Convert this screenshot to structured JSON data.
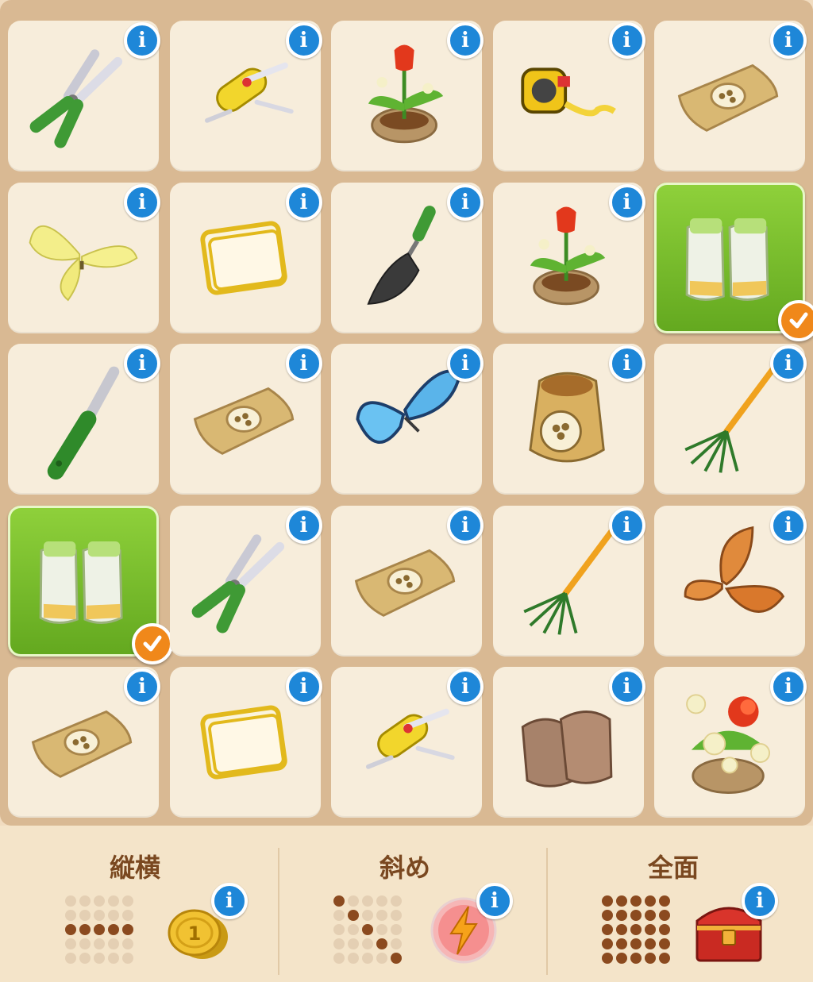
{
  "grid": {
    "rows": 5,
    "cols": 5,
    "cells": [
      {
        "item": "pruning-shears",
        "marked": false
      },
      {
        "item": "pocket-knife",
        "marked": false
      },
      {
        "item": "potted-tulip",
        "marked": false
      },
      {
        "item": "tape-measure",
        "marked": false
      },
      {
        "item": "seed-packet",
        "marked": false
      },
      {
        "item": "yellow-butterfly",
        "marked": false
      },
      {
        "item": "cloth-towel",
        "marked": false
      },
      {
        "item": "garden-trowel",
        "marked": false
      },
      {
        "item": "potted-tulip",
        "marked": false
      },
      {
        "item": "garden-gloves",
        "marked": true
      },
      {
        "item": "garden-knife",
        "marked": false
      },
      {
        "item": "seed-packet",
        "marked": false
      },
      {
        "item": "blue-butterfly",
        "marked": false
      },
      {
        "item": "seed-sack",
        "marked": false
      },
      {
        "item": "garden-rake",
        "marked": false
      },
      {
        "item": "garden-gloves",
        "marked": true
      },
      {
        "item": "pruning-shears",
        "marked": false
      },
      {
        "item": "seed-packet",
        "marked": false
      },
      {
        "item": "garden-rake",
        "marked": false
      },
      {
        "item": "orange-butterfly",
        "marked": false
      },
      {
        "item": "seed-packet",
        "marked": false
      },
      {
        "item": "cloth-towel",
        "marked": false
      },
      {
        "item": "pocket-knife",
        "marked": false
      },
      {
        "item": "leather-gloves",
        "marked": false
      },
      {
        "item": "flower-pot",
        "marked": false
      }
    ]
  },
  "info_glyph": "i",
  "rewards": [
    {
      "title": "縦横",
      "reward_icon": "gold-coins-icon",
      "pattern": [
        0,
        0,
        0,
        0,
        0,
        0,
        0,
        0,
        0,
        0,
        1,
        1,
        1,
        1,
        1,
        0,
        0,
        0,
        0,
        0,
        0,
        0,
        0,
        0,
        0
      ]
    },
    {
      "title": "斜め",
      "reward_icon": "energy-orb-icon",
      "pattern": [
        1,
        0,
        0,
        0,
        0,
        0,
        1,
        0,
        0,
        0,
        0,
        0,
        1,
        0,
        0,
        0,
        0,
        0,
        1,
        0,
        0,
        0,
        0,
        0,
        1
      ]
    },
    {
      "title": "全面",
      "reward_icon": "treasure-chest-icon",
      "pattern": [
        1,
        1,
        1,
        1,
        1,
        1,
        1,
        1,
        1,
        1,
        1,
        1,
        1,
        1,
        1,
        1,
        1,
        1,
        1,
        1,
        1,
        1,
        1,
        1,
        1
      ]
    }
  ],
  "colors": {
    "board": "#d9b993",
    "cell": "#f7eddb",
    "marked_cell": "#7bc42b",
    "info_badge": "#1e87d8",
    "check_badge": "#f0881a",
    "title_text": "#7a4820",
    "dot_on": "#8b4a1f",
    "dot_off": "#e4cfb3"
  }
}
